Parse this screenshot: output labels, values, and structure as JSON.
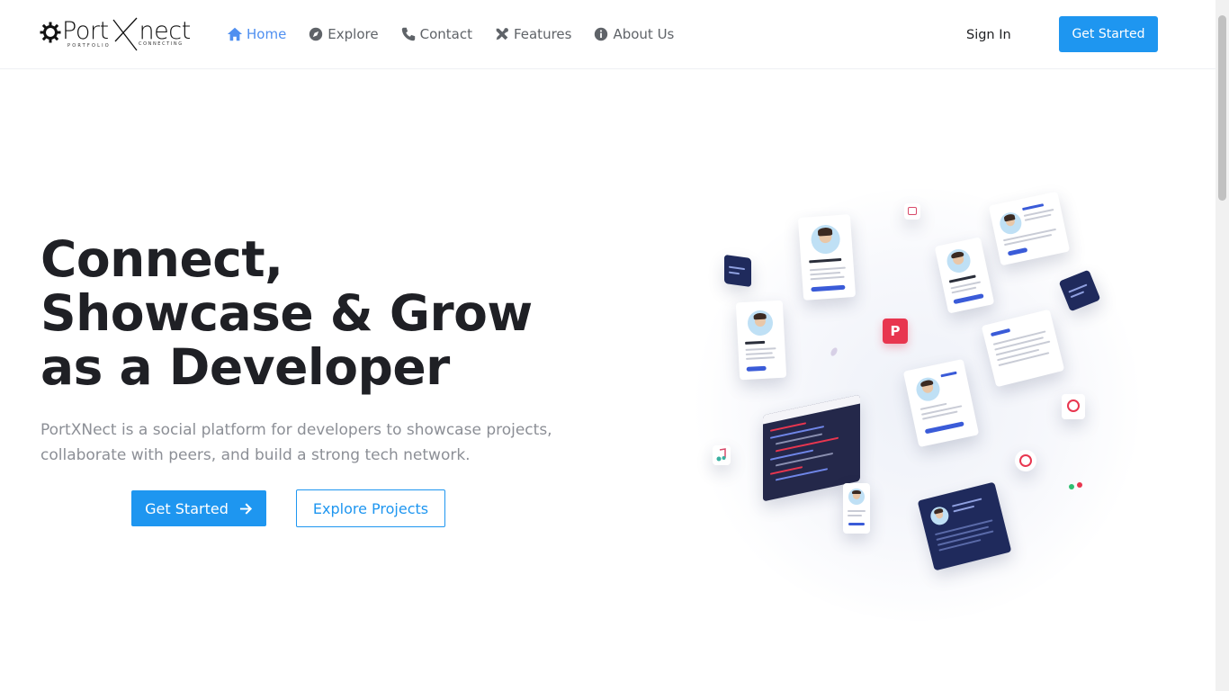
{
  "brand": {
    "name": "PortXNect",
    "logo_word": "Port",
    "logo_tail": "nect",
    "tagline_left": "PORTFOLIO",
    "tagline_right": "CONNECTING"
  },
  "nav": {
    "items": [
      {
        "label": "Home",
        "icon": "home-icon",
        "active": true
      },
      {
        "label": "Explore",
        "icon": "compass-icon",
        "active": false
      },
      {
        "label": "Contact",
        "icon": "phone-icon",
        "active": false
      },
      {
        "label": "Features",
        "icon": "tools-icon",
        "active": false
      },
      {
        "label": "About Us",
        "icon": "info-icon",
        "active": false
      }
    ],
    "sign_in": "Sign In",
    "get_started": "Get Started"
  },
  "hero": {
    "title_lines": [
      "Connect,",
      "Showcase & Grow",
      "as a Developer"
    ],
    "description": "PortXNect is a social platform for developers to showcase projects, collaborate with peers, and build a strong tech network.",
    "primary_button": "Get Started",
    "secondary_button": "Explore Projects"
  },
  "illustration": {
    "badge_text": "P"
  },
  "colors": {
    "accent": "#1e96f0",
    "nav_active": "#4f8ff0",
    "text_dark": "#1f2025",
    "text_muted": "#8c8f96",
    "card_dark": "#1f2a5c",
    "badge_red": "#e8364f"
  }
}
